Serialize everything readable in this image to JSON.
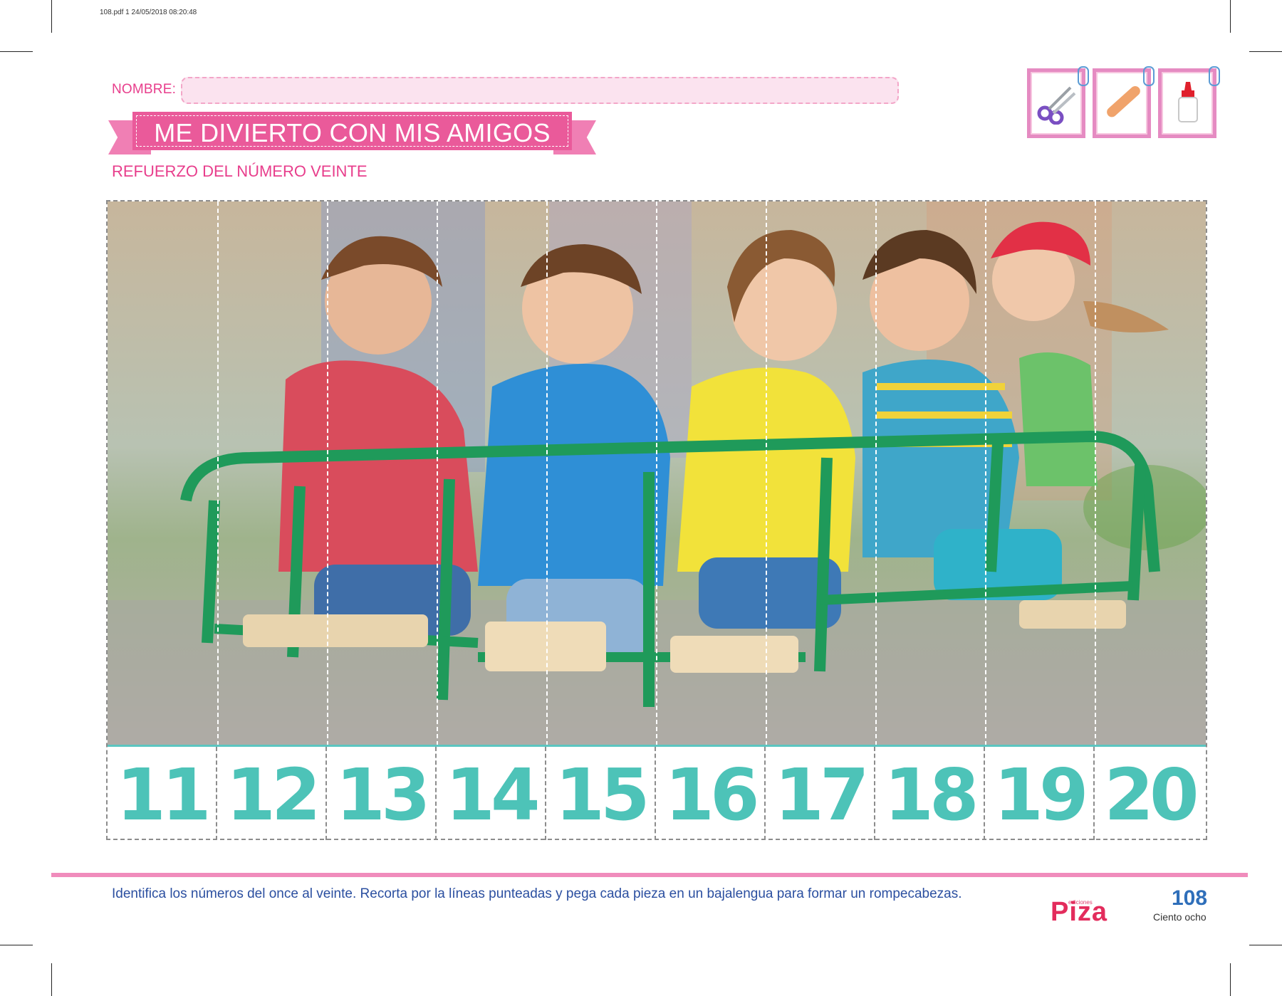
{
  "print_header": "108.pdf   1   24/05/2018   08:20:48",
  "name_label": "NOMBRE:",
  "title": "ME DIVIERTO CON MIS AMIGOS",
  "subtitle": "REFUERZO DEL NÚMERO VEINTE",
  "tools": [
    {
      "icon": "scissors-icon"
    },
    {
      "icon": "popsicle-stick-icon"
    },
    {
      "icon": "glue-bottle-icon"
    }
  ],
  "puzzle_numbers": [
    "11",
    "12",
    "13",
    "14",
    "15",
    "16",
    "17",
    "18",
    "19",
    "20"
  ],
  "instruction": "Identifica los números del once al veinte. Recorta por la líneas punteadas y pega cada pieza en un bajalengua para formar un rompecabezas.",
  "publisher_small": "ediciones",
  "publisher": "Piza",
  "page_number": "108",
  "page_words": "Ciento ocho",
  "colors": {
    "accent_pink": "#ea5a9a",
    "number_teal": "#4dc3b8",
    "instruction_blue": "#2b4fa0",
    "page_blue": "#2f6fba"
  }
}
